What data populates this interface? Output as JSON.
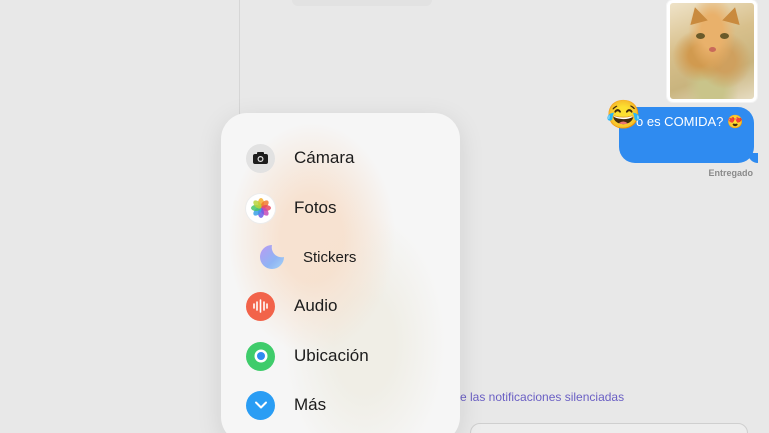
{
  "conversation": {
    "message_text": "o es COMIDA? 😍",
    "message_emoji": "😂",
    "delivery_status": "Entregado",
    "notification_notice": "e las notificaciones silenciadas"
  },
  "attachment_menu": {
    "items": [
      {
        "label": "Cámara",
        "icon": "camera-icon"
      },
      {
        "label": "Fotos",
        "icon": "photos-icon"
      },
      {
        "label": "Stickers",
        "icon": "stickers-icon"
      },
      {
        "label": "Audio",
        "icon": "audio-waveform-icon"
      },
      {
        "label": "Ubicación",
        "icon": "location-icon"
      },
      {
        "label": "Más",
        "icon": "chevron-down-icon"
      }
    ]
  },
  "colors": {
    "bubble": "#2f8bf0",
    "audio": "#f2634a",
    "location": "#3fcc6b",
    "more": "#2a9df4",
    "notice_text": "#6a5fc4"
  }
}
